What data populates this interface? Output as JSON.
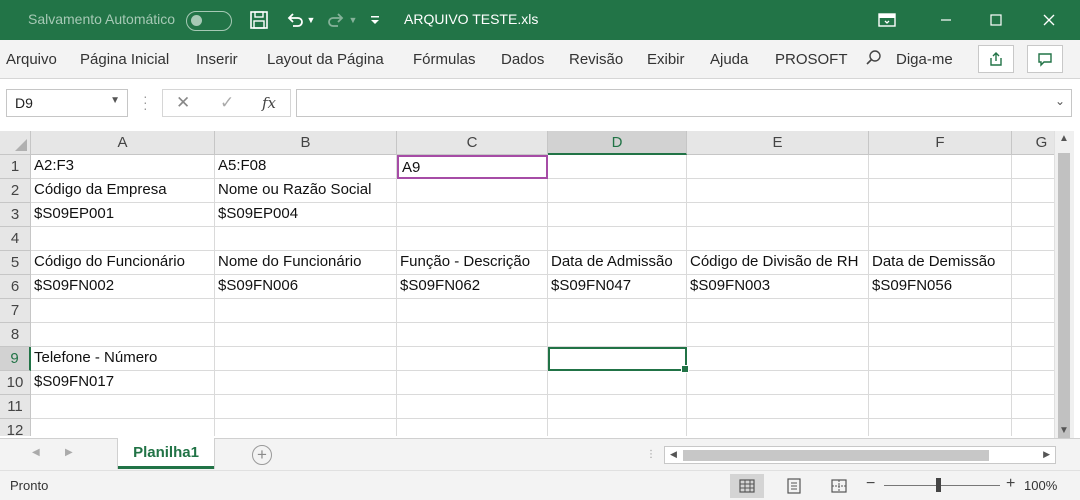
{
  "titlebar": {
    "autosave_label": "Salvamento Automático",
    "file_name": "ARQUIVO TESTE.xls",
    "accent": "#227447"
  },
  "ribbon": {
    "tabs": [
      "Arquivo",
      "Página Inicial",
      "Inserir",
      "Layout da Página",
      "Fórmulas",
      "Dados",
      "Revisão",
      "Exibir",
      "Ajuda",
      "PROSOFT"
    ],
    "tell_me": "Diga-me"
  },
  "formula_bar": {
    "name_box": "D9",
    "fx_label": "fx",
    "content": ""
  },
  "grid": {
    "columns": [
      "A",
      "B",
      "C",
      "D",
      "E",
      "F",
      "G"
    ],
    "rows": [
      "1",
      "2",
      "3",
      "4",
      "5",
      "6",
      "7",
      "8",
      "9",
      "10",
      "11",
      "12"
    ],
    "cells": {
      "r1": [
        "A2:F3",
        "A5:F08",
        "A9",
        "",
        "",
        ""
      ],
      "r2": [
        "Código da Empresa",
        "Nome ou Razão Social",
        "",
        "",
        "",
        ""
      ],
      "r3": [
        "$S09EP001",
        "$S09EP004",
        "",
        "",
        "",
        ""
      ],
      "r4": [
        "",
        "",
        "",
        "",
        "",
        ""
      ],
      "r5": [
        "Código do Funcionário",
        "Nome do Funcionário",
        "Função - Descrição",
        "Data de Admissão",
        "Código de Divisão de RH",
        "Data de Demissão"
      ],
      "r6": [
        "$S09FN002",
        "$S09FN006",
        "$S09FN062",
        "$S09FN047",
        "$S09FN003",
        "$S09FN056"
      ],
      "r7": [
        "",
        "",
        "",
        "",
        "",
        ""
      ],
      "r8": [
        "",
        "",
        "",
        "",
        "",
        ""
      ],
      "r9": [
        "Telefone - Número",
        "",
        "",
        "",
        "",
        ""
      ],
      "r10": [
        "$S09FN017",
        "",
        "",
        "",
        "",
        ""
      ],
      "r11": [
        "",
        "",
        "",
        "",
        "",
        ""
      ],
      "r12": [
        "",
        "",
        "",
        "",
        "",
        ""
      ]
    },
    "active_cell": "D9",
    "selection_color": "#217346",
    "highlight_color": "#a64ca6"
  },
  "sheets": {
    "tabs": [
      "Planilha1"
    ],
    "active": "Planilha1",
    "add_label": "+"
  },
  "statusbar": {
    "ready": "Pronto",
    "zoom": "100%",
    "zoom_minus": "−",
    "zoom_plus": "+"
  }
}
